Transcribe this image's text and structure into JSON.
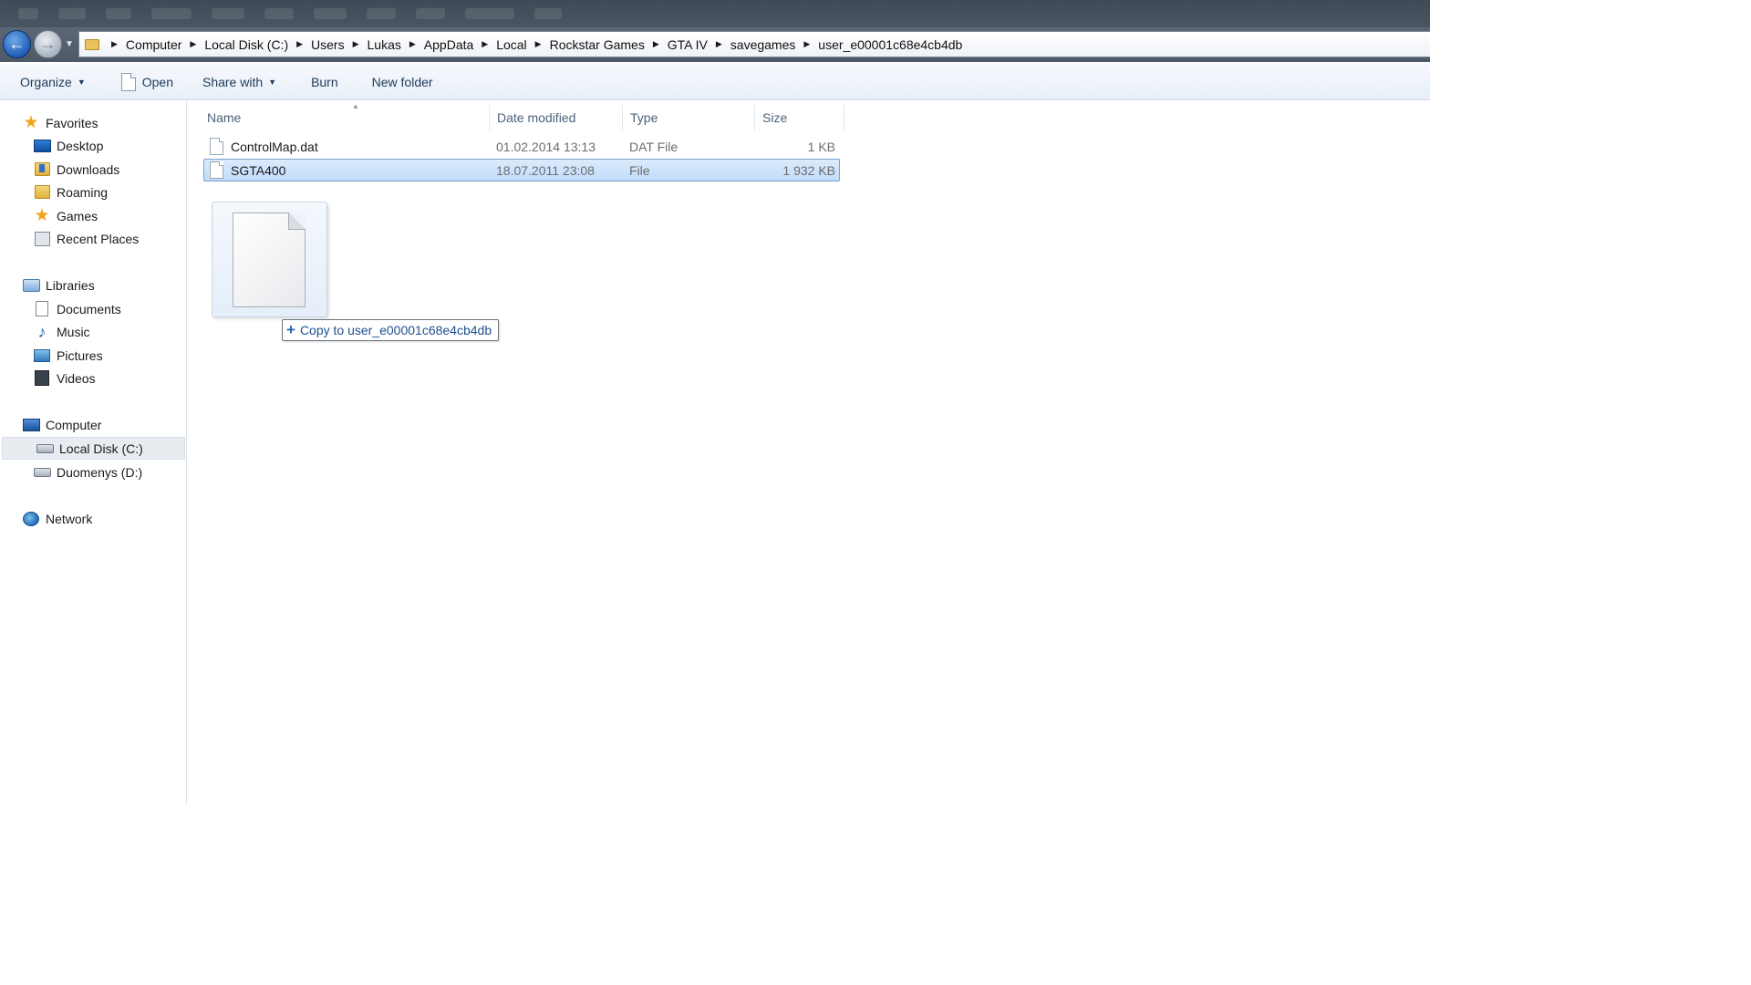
{
  "breadcrumb": [
    "Computer",
    "Local Disk (C:)",
    "Users",
    "Lukas",
    "AppData",
    "Local",
    "Rockstar Games",
    "GTA IV",
    "savegames",
    "user_e00001c68e4cb4db"
  ],
  "toolbar": {
    "organize": "Organize",
    "open": "Open",
    "share_with": "Share with",
    "burn": "Burn",
    "new_folder": "New folder"
  },
  "nav": {
    "favorites": "Favorites",
    "desktop": "Desktop",
    "downloads": "Downloads",
    "roaming": "Roaming",
    "games": "Games",
    "recent_places": "Recent Places",
    "libraries": "Libraries",
    "documents": "Documents",
    "music": "Music",
    "pictures": "Pictures",
    "videos": "Videos",
    "computer": "Computer",
    "local_disk": "Local Disk (C:)",
    "duomenys": "Duomenys (D:)",
    "network": "Network"
  },
  "columns": {
    "name": "Name",
    "date": "Date modified",
    "type": "Type",
    "size": "Size"
  },
  "files": [
    {
      "name": "ControlMap.dat",
      "date": "01.02.2014 13:13",
      "type": "DAT File",
      "size": "1 KB"
    },
    {
      "name": "SGTA400",
      "date": "18.07.2011 23:08",
      "type": "File",
      "size": "1 932 KB"
    }
  ],
  "drag": {
    "tooltip": "Copy to user_e00001c68e4cb4db"
  }
}
